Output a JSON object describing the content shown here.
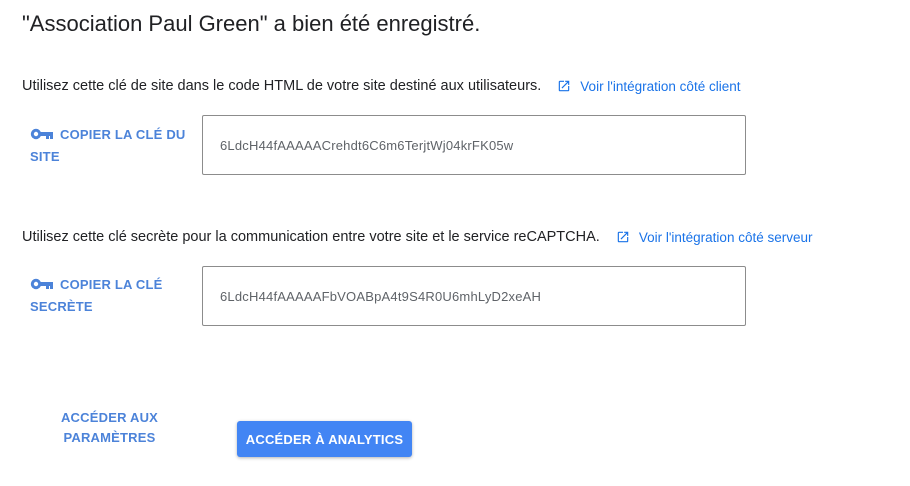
{
  "header": {
    "title": "\"Association Paul Green\" a bien été enregistré."
  },
  "site_key": {
    "description": "Utilisez cette clé de site dans le code HTML de votre site destiné aux utilisateurs.",
    "link_label": "Voir l'intégration côté client",
    "copy_line1": "COPIER LA CLÉ DU",
    "copy_line2": "SITE",
    "value": "6LdcH44fAAAAACrehdt6C6m6TerjtWj04krFK05w"
  },
  "secret_key": {
    "description": "Utilisez cette clé secrète pour la communication entre votre site et le service reCAPTCHA.",
    "link_label": "Voir l'intégration côté serveur",
    "copy_line1": "COPIER LA CLÉ",
    "copy_line2": "SECRÈTE",
    "value": "6LdcH44fAAAAAFbVOABpA4t9S4R0U6mhLyD2xeAH"
  },
  "footer": {
    "settings_line1": "ACCÉDER AUX",
    "settings_line2": "PARAMÈTRES",
    "analytics_label": "ACCÉDER À ANALYTICS"
  },
  "colors": {
    "accent": "#1a73e8",
    "button_bg": "#4285f4",
    "text": "#202124",
    "muted": "#5f6368"
  },
  "icons": {
    "key": "key-icon",
    "external_link": "open-in-new-icon"
  }
}
